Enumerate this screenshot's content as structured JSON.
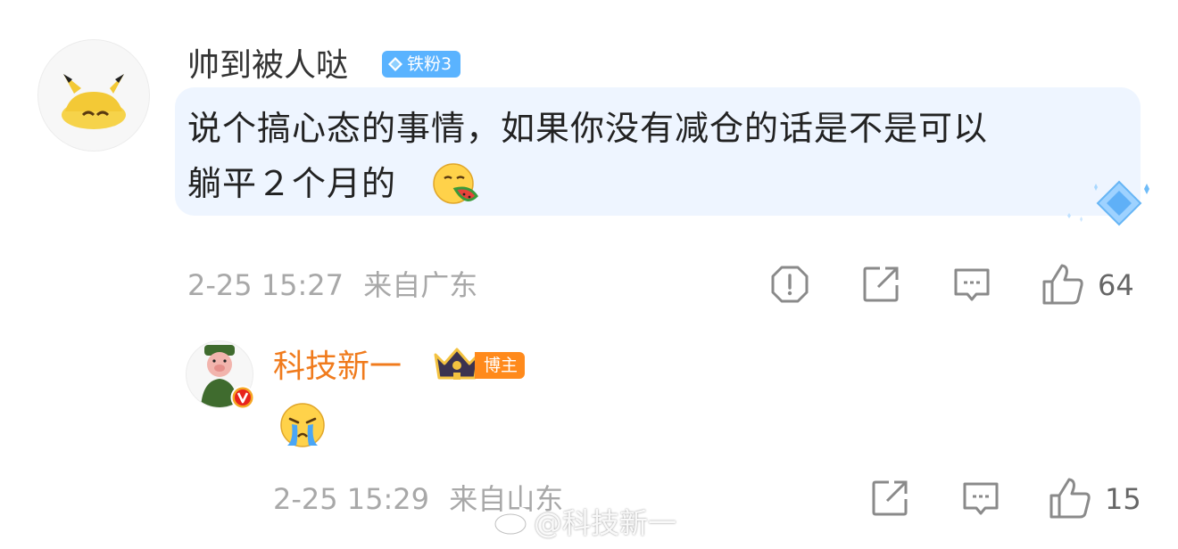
{
  "comment": {
    "author": "帅到被人哒",
    "fan_badge": "铁粉3",
    "text": "说个搞心态的事情，如果你没有减仓的话是不是可以躺平２个月的",
    "text_line1": "说个搞心态的事情，如果你没有减仓的话是不是可以",
    "text_line2": "躺平２个月的",
    "time": "2-25 15:27",
    "location": "来自广东",
    "like_count": "64"
  },
  "reply": {
    "author": "科技新一",
    "role_badge": "博主",
    "time": "2-25 15:29",
    "location": "来自山东",
    "like_count": "15"
  },
  "watermark": "@科技新一",
  "icons": {
    "report": "shield-report-icon",
    "repost": "share-edit-icon",
    "reply": "comment-icon",
    "like": "thumbs-up-icon"
  },
  "colors": {
    "blogger_name": "#f07b1d",
    "fan_badge": "#5ab3ff",
    "bubble": "#eef5ff",
    "meta": "#a8a8a8"
  }
}
